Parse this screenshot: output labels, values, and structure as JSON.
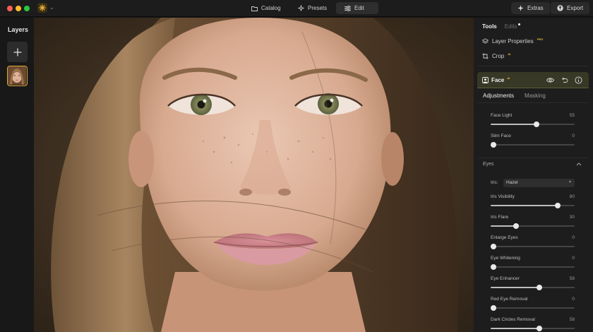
{
  "app": {
    "colors": {
      "accent": "#e0a83a",
      "face_header": "#373825",
      "panel": "#1d1d1d"
    },
    "traffic_lights": [
      "#ff5f57",
      "#febc2e",
      "#28c840"
    ]
  },
  "toolbar": {
    "catalog_label": "Catalog",
    "presets_label": "Presets",
    "edit_label": "Edit",
    "extras_label": "Extras",
    "export_label": "Export"
  },
  "layers": {
    "title": "Layers"
  },
  "panel": {
    "tab_tools": "Tools",
    "tab_edits": "Edits",
    "layer_properties_label": "Layer Properties",
    "layer_properties_badge": "PRO",
    "crop_label": "Crop",
    "crop_badge": "AI"
  },
  "face": {
    "title": "Face",
    "badge": "AI",
    "subtab_adjustments": "Adjustments",
    "subtab_masking": "Masking",
    "sliders": [
      {
        "label": "Face Light",
        "value": 55,
        "fraction": 0.55
      },
      {
        "label": "Slim Face",
        "value": 0,
        "fraction": 0.0
      }
    ],
    "eyes_section": "Eyes",
    "iris_label": "Iris:",
    "iris_value": "Hazel",
    "eye_sliders": [
      {
        "label": "Iris Visibility",
        "value": 80,
        "fraction": 0.8
      },
      {
        "label": "Iris Flare",
        "value": 30,
        "fraction": 0.3
      },
      {
        "label": "Enlarge Eyes",
        "value": 0,
        "fraction": 0.0
      },
      {
        "label": "Eye Whitening",
        "value": 0,
        "fraction": 0.0
      },
      {
        "label": "Eye Enhancer",
        "value": 58,
        "fraction": 0.58
      },
      {
        "label": "Red Eye Removal",
        "value": 0,
        "fraction": 0.0
      },
      {
        "label": "Dark Circles Removal",
        "value": 58,
        "fraction": 0.58
      }
    ]
  }
}
